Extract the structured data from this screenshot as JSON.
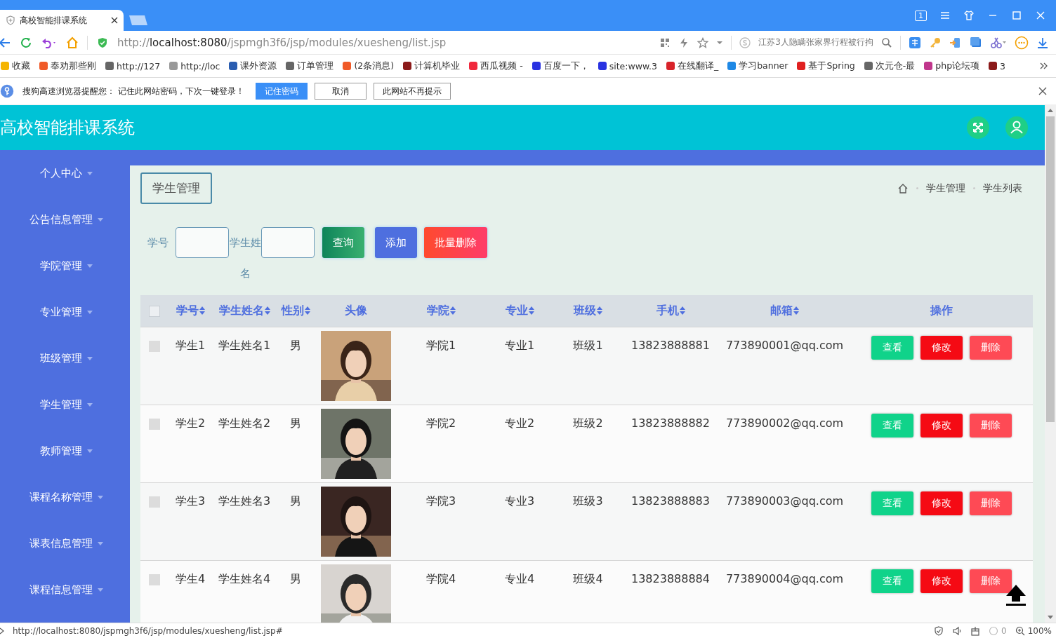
{
  "browser": {
    "tab_title": "高校智能排课系统",
    "url_prefix": "http://",
    "url_host": "localhost:8080",
    "url_path": "/jspmgh3f6/jsp/modules/xuesheng/list.jsp",
    "search_text": "江苏3人隐瞒张家界行程被行拘",
    "window_badge": "1"
  },
  "bookmarks": [
    {
      "label": "收藏",
      "color": "#f5b400"
    },
    {
      "label": "奉劝那些刚",
      "color": "#f05a28"
    },
    {
      "label": "http://127",
      "color": "#666666"
    },
    {
      "label": "http://loc",
      "color": "#999999"
    },
    {
      "label": "课外资源",
      "color": "#2a5db0"
    },
    {
      "label": "订单管理",
      "color": "#666666"
    },
    {
      "label": "(2条消息)",
      "color": "#f05a28"
    },
    {
      "label": "计算机毕业",
      "color": "#8b1a1a"
    },
    {
      "label": "西瓜视频 -",
      "color": "#f0283c"
    },
    {
      "label": "百度一下，",
      "color": "#2932e1"
    },
    {
      "label": "site:www.3",
      "color": "#2932e1"
    },
    {
      "label": "在线翻译_",
      "color": "#d8232a"
    },
    {
      "label": "学习banner",
      "color": "#1e88e5"
    },
    {
      "label": "基于Spring",
      "color": "#e02020"
    },
    {
      "label": "次元仓-最",
      "color": "#666666"
    },
    {
      "label": "php论坛项",
      "color": "#c0368c"
    },
    {
      "label": "3",
      "color": "#8b1a1a"
    }
  ],
  "notice": {
    "text": "搜狗高速浏览器提醒您： 记住此网站密码，下次一键登录！",
    "buttons": [
      {
        "label": "记住密码",
        "kind": "primary"
      },
      {
        "label": "取消",
        "kind": "plain"
      },
      {
        "label": "此网站不再提示",
        "kind": "plain"
      }
    ]
  },
  "app": {
    "title": "高校智能排课系统"
  },
  "sidebar": {
    "items": [
      {
        "label": "个人中心",
        "selected": false
      },
      {
        "label": "公告信息管理",
        "selected": false
      },
      {
        "label": "学院管理",
        "selected": false
      },
      {
        "label": "专业管理",
        "selected": false
      },
      {
        "label": "班级管理",
        "selected": false
      },
      {
        "label": "学生管理",
        "selected": false
      },
      {
        "label": "教师管理",
        "selected": false
      },
      {
        "label": "课程名称管理",
        "selected": false
      },
      {
        "label": "课表信息管理",
        "selected": false
      },
      {
        "label": "课程信息管理",
        "selected": false
      }
    ]
  },
  "page_title": "学生管理",
  "breadcrumb": [
    "学生管理",
    "学生列表"
  ],
  "search": {
    "fields": [
      {
        "label": "学号"
      },
      {
        "label": "学生姓名"
      }
    ],
    "buttons": [
      {
        "label": "查询",
        "kind": "query"
      },
      {
        "label": "添加",
        "kind": "add"
      },
      {
        "label": "批量删除",
        "kind": "delete"
      }
    ]
  },
  "table": {
    "select_all_checked": false,
    "columns": [
      {
        "label": "学号",
        "sortable": true
      },
      {
        "label": "学生姓名",
        "sortable": true
      },
      {
        "label": "性别",
        "sortable": true
      },
      {
        "label": "头像",
        "sortable": false
      },
      {
        "label": "学院",
        "sortable": true
      },
      {
        "label": "专业",
        "sortable": true
      },
      {
        "label": "班级",
        "sortable": true
      },
      {
        "label": "手机",
        "sortable": true
      },
      {
        "label": "邮箱",
        "sortable": true
      },
      {
        "label": "操作",
        "sortable": false
      }
    ],
    "rows": [
      {
        "checked": false,
        "cells": [
          "学生1",
          "学生姓名1",
          "男"
        ],
        "photo": {
          "kind": "picture"
        },
        "cells2": [
          "学院1",
          "专业1",
          "班级1",
          "13823888881",
          "773890001@qq.com"
        ],
        "actions": [
          {
            "label": "查看",
            "kind": "view"
          },
          {
            "label": "修改",
            "kind": "edit"
          },
          {
            "label": "删除",
            "kind": "delete"
          }
        ]
      },
      {
        "checked": false,
        "cells": [
          "学生2",
          "学生姓名2",
          "男"
        ],
        "photo": {
          "kind": "picture"
        },
        "cells2": [
          "学院2",
          "专业2",
          "班级2",
          "13823888882",
          "773890002@qq.com"
        ],
        "actions": [
          {
            "label": "查看",
            "kind": "view"
          },
          {
            "label": "修改",
            "kind": "edit"
          },
          {
            "label": "删除",
            "kind": "delete"
          }
        ]
      },
      {
        "checked": false,
        "cells": [
          "学生3",
          "学生姓名3",
          "男"
        ],
        "photo": {
          "kind": "picture"
        },
        "cells2": [
          "学院3",
          "专业3",
          "班级3",
          "13823888883",
          "773890003@qq.com"
        ],
        "actions": [
          {
            "label": "查看",
            "kind": "view"
          },
          {
            "label": "修改",
            "kind": "edit"
          },
          {
            "label": "删除",
            "kind": "delete"
          }
        ]
      },
      {
        "checked": false,
        "cells": [
          "学生4",
          "学生姓名4",
          "男"
        ],
        "photo": {
          "kind": "picture"
        },
        "cells2": [
          "学院4",
          "专业4",
          "班级4",
          "13823888884",
          "773890004@qq.com"
        ],
        "actions": [
          {
            "label": "查看",
            "kind": "view"
          },
          {
            "label": "修改",
            "kind": "edit"
          },
          {
            "label": "删除",
            "kind": "delete"
          }
        ]
      }
    ]
  },
  "status_bar": {
    "url": "http://localhost:8080/jspmgh3f6/jsp/modules/xuesheng/list.jsp#",
    "count": "0",
    "zoom": "100%"
  }
}
